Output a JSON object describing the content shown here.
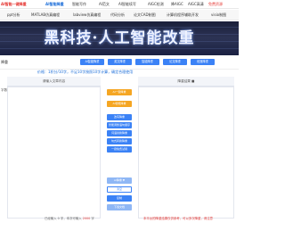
{
  "topnav": {
    "logo": "AI智能一键降重",
    "items": [
      "AI智能降重",
      "智能写作",
      "AI范文",
      "AI智能续写",
      "AIGC检测",
      "降AIGC",
      "AIGC高清",
      "免费资源"
    ],
    "active_index": 0,
    "red_index": 7
  },
  "subnav": {
    "items": [
      "ppt分析",
      "MATLAB仿真编程",
      "labview仿真编程",
      "代码分析",
      "论文CAD制图",
      "计算机程序辅助开发",
      "visio制图"
    ]
  },
  "banner": {
    "title": "黑科技·人工智能改重"
  },
  "toolbar": {
    "label": "降重",
    "tabs": [
      {
        "label": "AI智能降重",
        "color": "#3b82f6"
      },
      {
        "label": "英文降重",
        "color": "#3b82f6"
      },
      {
        "label": "智能降重",
        "color": "#3b82f6"
      },
      {
        "label": "论文降重",
        "color": "#3b82f6"
      },
      {
        "label": "段落降重",
        "color": "#3b82f6"
      }
    ]
  },
  "notice": "价格：1积分/10字，不足10字按照10字计算，确定合理使用",
  "left_label": "字数",
  "left_pane": {
    "header": "请输入文章内容"
  },
  "right_pane": {
    "header": "降重结果 ■"
  },
  "buttons": [
    {
      "label": "AI一键降重",
      "style": "orange"
    },
    {
      "label": "AI智能降重",
      "style": "orange"
    },
    {
      "label": "改写降重",
      "style": "blue"
    },
    {
      "label": "智能调整语句顺序",
      "style": "blue"
    },
    {
      "label": "词语替换降重",
      "style": "blue"
    },
    {
      "label": "句式转换降重",
      "style": "blue"
    },
    {
      "label": "一键免费试用",
      "style": "blue"
    },
    {
      "label": "AI降重 ▼",
      "style": "lightblue"
    },
    {
      "label": "清空",
      "style": "outline"
    },
    {
      "label": "复制",
      "style": "blue"
    },
    {
      "label": "下载文档",
      "style": "lightblue"
    }
  ],
  "footer": {
    "left_prefix": "已经输入 0 字，本次可输入",
    "left_limit": "2000",
    "left_suffix": "字",
    "right": "本平台的降重结果仅供参考，可以多次降重，请注意"
  }
}
